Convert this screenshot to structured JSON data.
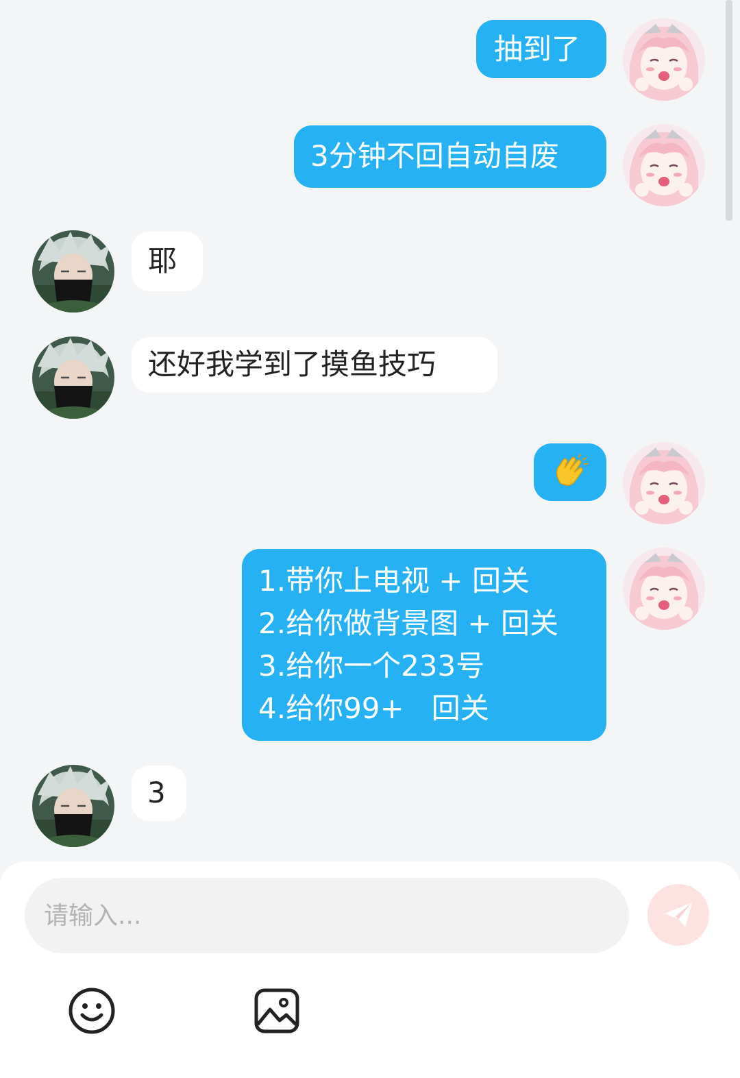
{
  "colors": {
    "self_bubble": "#25b1f4",
    "other_bubble": "#ffffff",
    "page_background": "#f4f5f7",
    "send_button": "#fde2e2"
  },
  "messages": [
    {
      "sender": "self",
      "avatar": "anime-girl-avatar",
      "lines": [
        "抽到了"
      ]
    },
    {
      "sender": "self",
      "avatar": "anime-girl-avatar",
      "lines": [
        "3分钟不回自动自废"
      ]
    },
    {
      "sender": "other",
      "avatar": "masked-ninja-avatar",
      "lines": [
        "耶"
      ]
    },
    {
      "sender": "other",
      "avatar": "masked-ninja-avatar",
      "lines": [
        "还好我学到了摸鱼技巧"
      ]
    },
    {
      "sender": "self",
      "avatar": "anime-girl-avatar",
      "emoji": "clapping-hands",
      "lines": [
        "👏"
      ]
    },
    {
      "sender": "self",
      "avatar": "anime-girl-avatar",
      "lines": [
        "1.带你上电视 + 回关",
        "2.给你做背景图 + 回关",
        "3.给你一个233号",
        "4.给你99+   回关"
      ]
    },
    {
      "sender": "other",
      "avatar": "masked-ninja-avatar",
      "lines": [
        "3"
      ]
    }
  ],
  "composer": {
    "placeholder": "请输入...",
    "value": "",
    "send_icon": "paper-plane-icon",
    "tools": [
      "emoji-icon",
      "image-icon"
    ]
  }
}
